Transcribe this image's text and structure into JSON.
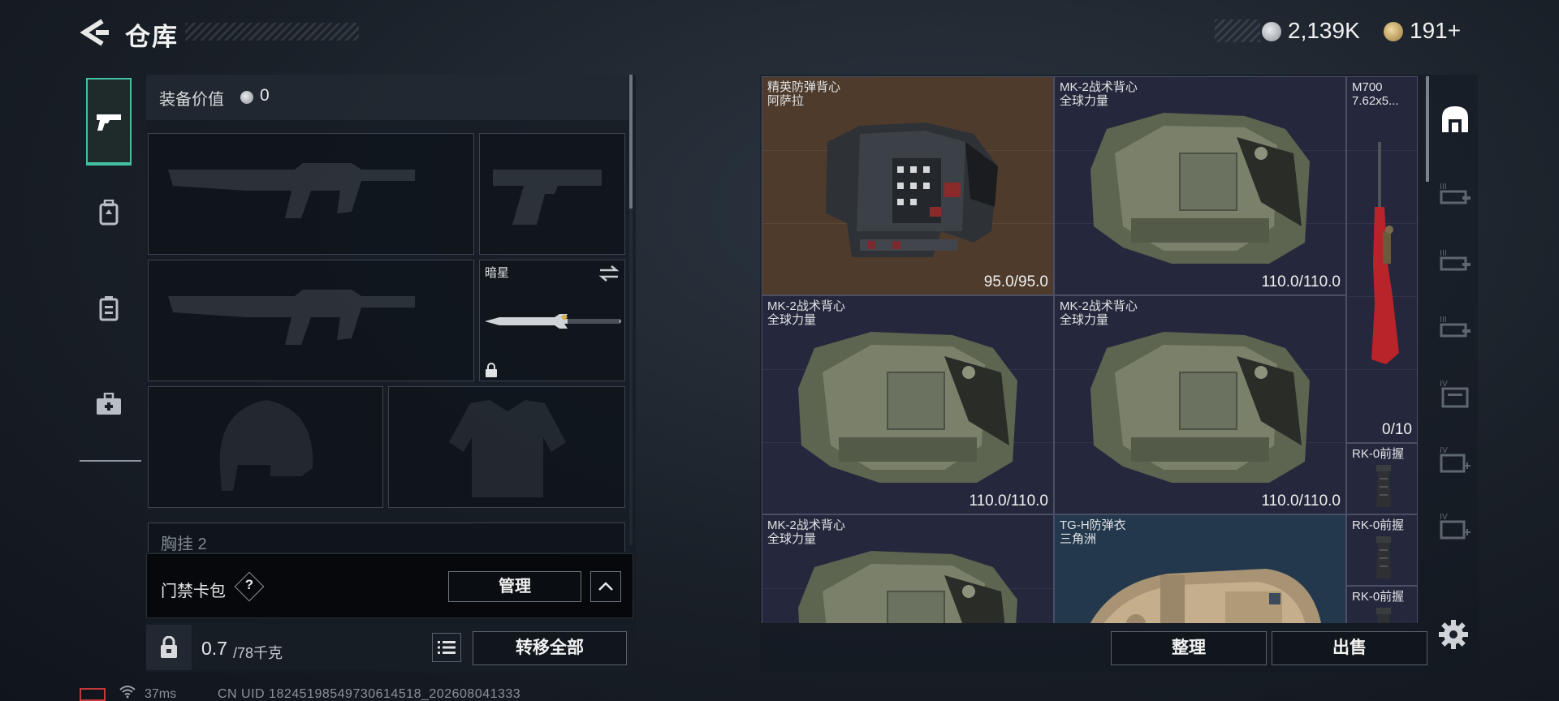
{
  "header": {
    "title": "仓库",
    "currency_silver": "2,139K",
    "currency_gold": "191+"
  },
  "nav": {
    "items": [
      {
        "name": "weapons",
        "icon": "pistol-icon",
        "active": true
      },
      {
        "name": "armor",
        "icon": "backpack-icon",
        "active": false
      },
      {
        "name": "chest-rig",
        "icon": "vest-icon",
        "active": false
      },
      {
        "name": "medkit",
        "icon": "medkit-icon",
        "active": false
      }
    ]
  },
  "equipment": {
    "value_label": "装备价值",
    "value": "0",
    "melee_slot": {
      "name": "暗星"
    },
    "chest_rig_label": "胸挂 2"
  },
  "card_pack": {
    "label": "门禁卡包",
    "help": "?",
    "manage_label": "管理"
  },
  "bottom_left": {
    "weight_value": "0.7",
    "weight_max": "/78千克",
    "transfer_label": "转移全部"
  },
  "status": {
    "ping": "37ms",
    "uid": "CN UID 18245198549730614518_202608041333"
  },
  "stash": {
    "items": [
      {
        "name_line1": "精英防弹背心",
        "name_line2": "阿萨拉",
        "durability": "95.0/95.0",
        "kind": "elite-vest"
      },
      {
        "name_line1": "MK-2战术背心",
        "name_line2": "全球力量",
        "durability": "110.0/110.0",
        "kind": "mk2-vest"
      },
      {
        "name_line1": "M700",
        "name_line2": "7.62x5...",
        "durability": "0/10",
        "kind": "rifle"
      },
      {
        "name_line1": "MK-2战术背心",
        "name_line2": "全球力量",
        "durability": "110.0/110.0",
        "kind": "mk2-vest"
      },
      {
        "name_line1": "MK-2战术背心",
        "name_line2": "全球力量",
        "durability": "110.0/110.0",
        "kind": "mk2-vest"
      },
      {
        "name_line1": "RK-0前握",
        "kind": "grip"
      },
      {
        "name_line1": "MK-2战术背心",
        "name_line2": "全球力量",
        "kind": "mk2-vest"
      },
      {
        "name_line1": "TG-H防弹衣",
        "name_line2": "三角洲",
        "kind": "tg-vest"
      },
      {
        "name_line1": "RK-0前握",
        "kind": "grip"
      },
      {
        "name_line1": "RK-0前握",
        "kind": "grip"
      }
    ],
    "sort_label": "整理",
    "sell_label": "出售"
  },
  "side_tabs": [
    {
      "icon": "stash-all-icon",
      "active": true
    },
    {
      "icon": "stash-tier-3-icon",
      "label": "III"
    },
    {
      "icon": "stash-tier-3-icon",
      "label": "III"
    },
    {
      "icon": "stash-tier-3-icon",
      "label": "III"
    },
    {
      "icon": "stash-tier-4-icon",
      "label": "IV"
    },
    {
      "icon": "stash-tier-4-add-icon",
      "label": "IV"
    },
    {
      "icon": "stash-tier-4-add-icon",
      "label": "IV"
    }
  ],
  "colors": {
    "accent": "#43c1a4",
    "elite_bg": "#4e3b2c",
    "tg_bg": "#23384d",
    "grid_bg": "#25283c"
  }
}
